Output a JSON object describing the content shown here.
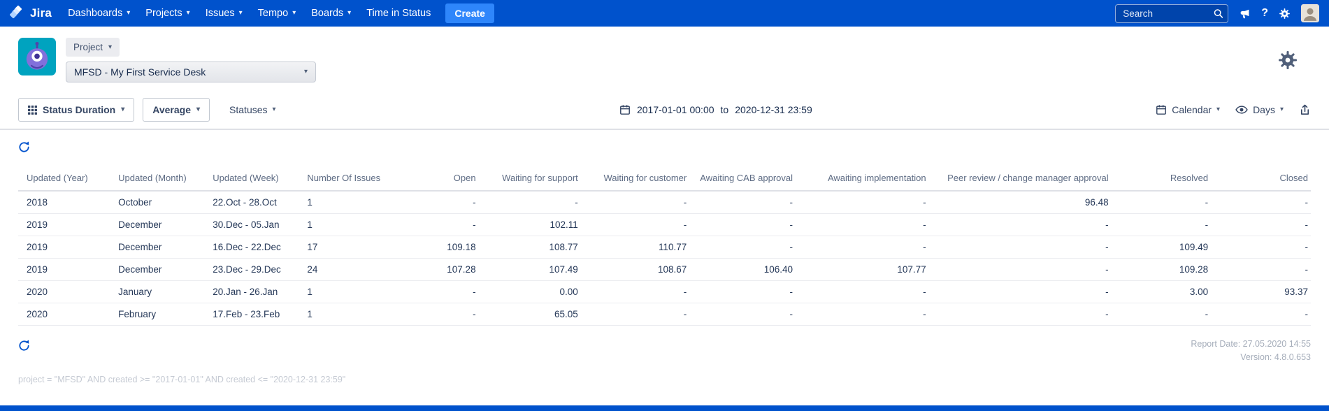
{
  "colors": {
    "nav_background": "#0052CC",
    "create_button": "#2E86FB",
    "accent_blue": "#0052CC",
    "project_avatar_teal": "#00A3BF",
    "project_avatar_purple": "#8270DB"
  },
  "icons": {
    "chevron_down": "▾",
    "help": "?"
  },
  "nav": {
    "brand": "Jira",
    "items": [
      {
        "label": "Dashboards",
        "dropdown": true
      },
      {
        "label": "Projects",
        "dropdown": true
      },
      {
        "label": "Issues",
        "dropdown": true
      },
      {
        "label": "Tempo",
        "dropdown": true
      },
      {
        "label": "Boards",
        "dropdown": true
      },
      {
        "label": "Time in Status",
        "dropdown": false
      }
    ],
    "create_label": "Create",
    "search_placeholder": "Search"
  },
  "project_header": {
    "project_button_label": "Project",
    "project_select_value": "MFSD - My First Service Desk"
  },
  "toolbar": {
    "status_duration_label": "Status Duration",
    "average_label": "Average",
    "statuses_label": "Statuses",
    "date_from": "2017-01-01 00:00",
    "date_separator": "to",
    "date_to": "2020-12-31 23:59",
    "calendar_label": "Calendar",
    "days_label": "Days"
  },
  "table": {
    "columns": [
      "Updated (Year)",
      "Updated (Month)",
      "Updated (Week)",
      "Number Of Issues",
      "Open",
      "Waiting for support",
      "Waiting for customer",
      "Awaiting CAB approval",
      "Awaiting implementation",
      "Peer review / change manager approval",
      "Resolved",
      "Closed"
    ],
    "rows": [
      [
        "2018",
        "October",
        "22.Oct - 28.Oct",
        "1",
        "-",
        "-",
        "-",
        "-",
        "-",
        "96.48",
        "-",
        "-"
      ],
      [
        "2019",
        "December",
        "30.Dec - 05.Jan",
        "1",
        "-",
        "102.11",
        "-",
        "-",
        "-",
        "-",
        "-",
        "-"
      ],
      [
        "2019",
        "December",
        "16.Dec - 22.Dec",
        "17",
        "109.18",
        "108.77",
        "110.77",
        "-",
        "-",
        "-",
        "109.49",
        "-"
      ],
      [
        "2019",
        "December",
        "23.Dec - 29.Dec",
        "24",
        "107.28",
        "107.49",
        "108.67",
        "106.40",
        "107.77",
        "-",
        "109.28",
        "-"
      ],
      [
        "2020",
        "January",
        "20.Jan - 26.Jan",
        "1",
        "-",
        "0.00",
        "-",
        "-",
        "-",
        "-",
        "3.00",
        "93.37"
      ],
      [
        "2020",
        "February",
        "17.Feb - 23.Feb",
        "1",
        "-",
        "65.05",
        "-",
        "-",
        "-",
        "-",
        "-",
        "-"
      ]
    ]
  },
  "footer": {
    "report_date": "Report Date: 27.05.2020 14:55",
    "version": "Version: 4.8.0.653",
    "query": "project = \"MFSD\" AND created >= \"2017-01-01\" AND created <= \"2020-12-31 23:59\""
  }
}
